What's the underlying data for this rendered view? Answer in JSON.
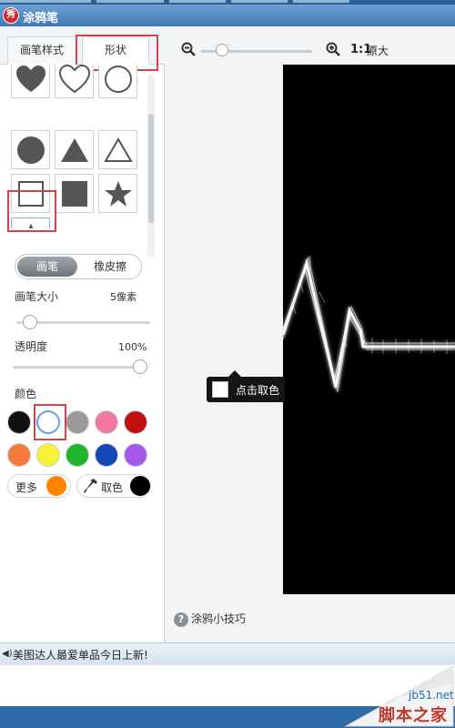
{
  "window": {
    "title": "涂鸦笔",
    "logo_text": "秀"
  },
  "tabs": [
    {
      "label": "画笔样式"
    },
    {
      "label": "形状"
    }
  ],
  "shapes": [
    "heart-filled-icon",
    "heart-outline-icon",
    "circle-outline-icon",
    "circle-filled-icon",
    "triangle-filled-icon",
    "triangle-outline-icon",
    "square-outline-icon",
    "square-filled-icon",
    "star-filled-icon",
    "star-outline-icon"
  ],
  "mode_toggle": {
    "brush": "画笔",
    "eraser": "橡皮擦"
  },
  "brush_size": {
    "label": "画笔大小",
    "value": "5像素",
    "level": 0.05
  },
  "opacity": {
    "label": "透明度",
    "value": "100%",
    "level": 1.0
  },
  "color": {
    "label": "颜色",
    "swatches": [
      "#111111",
      "#ffffff",
      "#9a9a9a",
      "#f07aa0",
      "#bf0f10",
      "#f47a3c",
      "#f5f23a",
      "#1fb52a",
      "#1446b8",
      "#a35ae8"
    ],
    "selected_index": 1,
    "more_label": "更多",
    "more_color": "#ff8400",
    "picker_label": "取色",
    "picker_color": "#000000"
  },
  "zoom": {
    "one_to_one": "1:1",
    "original": "原大",
    "level": 0.15
  },
  "tooltip": {
    "text": "点击取色"
  },
  "tips": {
    "icon": "?",
    "label": "涂鸦小技巧"
  },
  "notification": {
    "text": "美图达人最爱单品今日上新!"
  },
  "watermark": {
    "url": "jb51.net",
    "text": "脚本之家"
  }
}
